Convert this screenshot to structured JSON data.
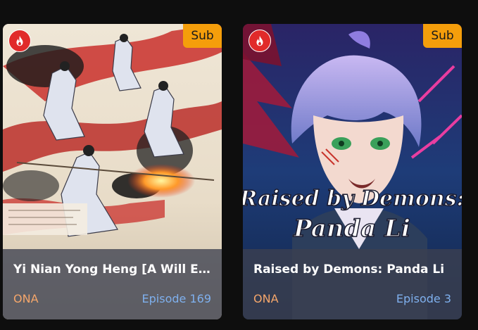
{
  "cards": [
    {
      "title": "Yi Nian Yong Heng [A Will Et...",
      "badge": "Sub",
      "type": "ONA",
      "episode": "Episode 169",
      "poster_icon": "ink-painting-cultivators",
      "badge_icon": "fire-icon"
    },
    {
      "title": "Raised by Demons: Panda Li",
      "badge": "Sub",
      "type": "ONA",
      "episode": "Episode 3",
      "poster_icon": "anime-boy-portrait",
      "badge_icon": "fire-icon",
      "poster_text_line1": "Raised by Demons:",
      "poster_text_line2": "Panda Li"
    }
  ],
  "colors": {
    "background": "#0e0e0e",
    "sub_badge": "#f59e0b",
    "fire_badge": "#e12a2a",
    "type_text": "#f5a66b",
    "episode_text": "#7fb0ee"
  }
}
